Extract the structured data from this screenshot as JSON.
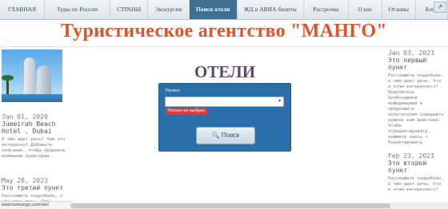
{
  "nav": {
    "items": [
      {
        "label": "ГЛАВНАЯ",
        "active": false
      },
      {
        "label": "Туры по России",
        "active": false
      },
      {
        "label": "СТРАНЫ",
        "active": false
      },
      {
        "label": "Экскурсии",
        "active": false
      },
      {
        "label": "Поиск отеля",
        "active": true
      },
      {
        "label": "ЖД и АВИА билеты",
        "active": false
      },
      {
        "label": "Рассрочка",
        "active": false
      },
      {
        "label": "О нас",
        "active": false
      },
      {
        "label": "Отзывы",
        "active": false
      },
      {
        "label": "Блог",
        "active": false
      }
    ],
    "corner_label": "↗"
  },
  "site": {
    "title": "Туристическое агентство \"МАНГО\""
  },
  "left_posts": [
    {
      "date": "Jan 01, 2020",
      "title": "Jumeirah Beach Hotel , Dubai",
      "text": "О чём идет речь? Чем это интересно? Добавьте описание, чтобы привлечь внимание аудитории..."
    },
    {
      "date": "May 28, 2023",
      "title": "Это третий пункт",
      "text": "Расскажите подробнее, о чём идет речь. Что"
    }
  ],
  "right_posts": [
    {
      "date": "Jan 03, 2023",
      "title": "Это первый пункт",
      "text": "Расскажите подробнее, о чём идет речь. Что в этом интересного? Поделитесь необходимой информацией и предложите посетителям совершить нужное вам действие. Чтобы отредактировать, нажмите здесь > Редактировать."
    },
    {
      "date": "Feb 23, 2023",
      "title": "Это второй пункт",
      "text": "Расскажите подробнее, о чём идет речь. Что в этом интересного?"
    }
  ],
  "hotels": {
    "heading": "ОТЕЛИ",
    "region_label": "Регион",
    "region_value": "",
    "error": "Регион не выбран",
    "search_label": "Поиск",
    "search_icon": "search-icon"
  },
  "status": {
    "url": "www.turmango.com/otel"
  },
  "colors": {
    "nav_active": "#3e6f93",
    "title": "#e05423",
    "heading": "#5a4a73",
    "search_box": "#2a6fa8",
    "error": "#d83c3c"
  }
}
